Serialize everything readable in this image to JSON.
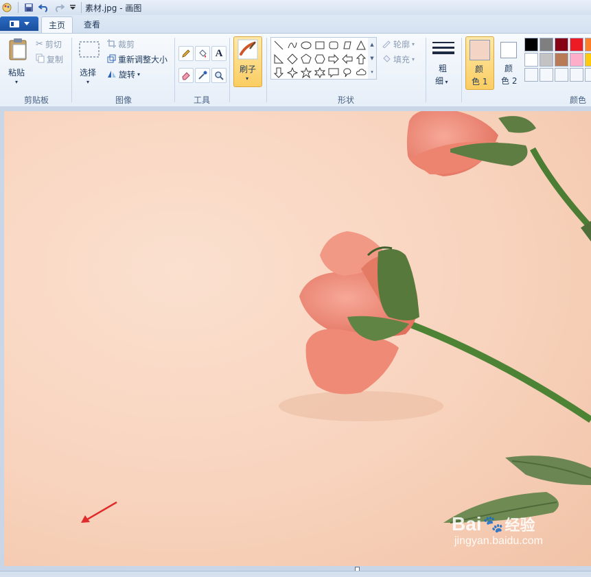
{
  "window": {
    "title": "素材.jpg - 画图"
  },
  "quick_access": {
    "icons": [
      "paint-app-icon",
      "save-icon",
      "undo-icon",
      "redo-icon",
      "customize-qa-icon"
    ]
  },
  "tabs": [
    {
      "label": "主页",
      "active": true
    },
    {
      "label": "查看",
      "active": false
    }
  ],
  "clipboard": {
    "paste_label": "粘贴",
    "cut_label": "剪切",
    "copy_label": "复制",
    "group_label": "剪贴板"
  },
  "image": {
    "select_label": "选择",
    "crop_label": "裁剪",
    "resize_label": "重新调整大小",
    "rotate_label": "旋转",
    "group_label": "图像"
  },
  "tools": {
    "group_label": "工具",
    "items": [
      "pencil-icon",
      "fill-icon",
      "text-icon",
      "eraser-icon",
      "color-picker-icon",
      "magnifier-icon"
    ]
  },
  "brush": {
    "label": "刷子"
  },
  "shapes": {
    "group_label": "形状",
    "outline_label": "轮廓",
    "fill_label": "填充"
  },
  "size": {
    "label_line1": "粗",
    "label_line2": "细"
  },
  "colors": {
    "color1_label_line1": "颜",
    "color1_label_line2": "色 1",
    "color2_label_line1": "颜",
    "color2_label_line2": "色 2",
    "group_label": "颜色",
    "color1_value": "#f4d4c4",
    "color2_value": "#ffffff",
    "palette_row1": [
      "#000000",
      "#7f7f7f",
      "#880015",
      "#ed1c24",
      "#ff7f27"
    ],
    "palette_row2": [
      "#ffffff",
      "#c3c3c3",
      "#b97a57",
      "#ffaec9",
      "#ffc90e"
    ]
  },
  "canvas": {
    "file": "素材.jpg",
    "arrow_color": "#e02b2b"
  },
  "watermark": {
    "brand": "Bai",
    "brand_suffix": "经验",
    "url": "jingyan.baidu.com"
  }
}
